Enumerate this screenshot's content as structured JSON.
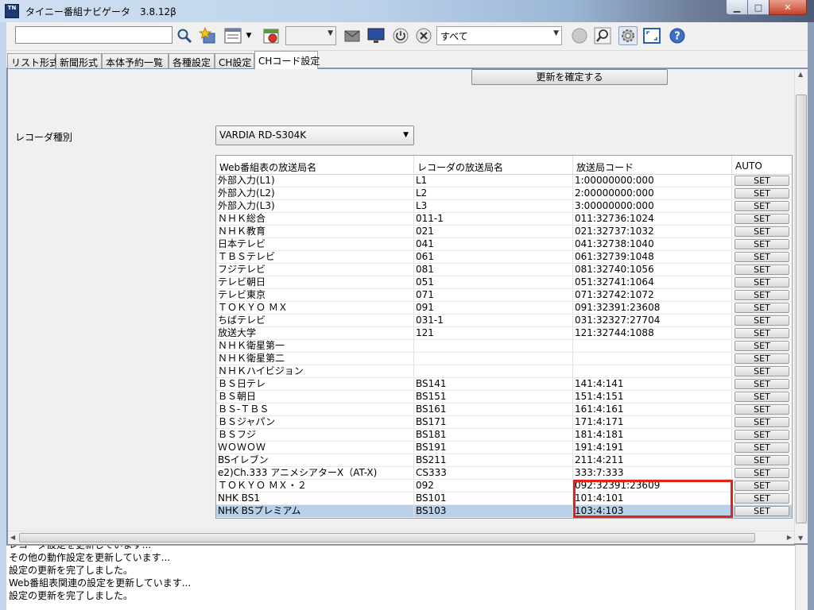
{
  "window": {
    "title": "タイニー番組ナビゲータ　3.8.12β",
    "icon_text": "TN"
  },
  "toolbar": {
    "search_value": "",
    "channel_combo_value": "",
    "filter_value": "すべて"
  },
  "tabs": [
    {
      "label": "リスト形式"
    },
    {
      "label": "新聞形式"
    },
    {
      "label": "本体予約一覧"
    },
    {
      "label": "各種設定"
    },
    {
      "label": "CH設定"
    },
    {
      "label": "CHコード設定"
    }
  ],
  "panel": {
    "update_button_label": "更新を確定する",
    "recorder_label": "レコーダ種別",
    "recorder_value": "VARDIA RD-S304K"
  },
  "table": {
    "headers": [
      "Web番組表の放送局名",
      "レコーダの放送局名",
      "放送局コード",
      "AUTO"
    ],
    "set_label": "SET",
    "rows": [
      {
        "web": "外部入力(L1)",
        "rec": "L1",
        "code": "1:00000000:000"
      },
      {
        "web": "外部入力(L2)",
        "rec": "L2",
        "code": "2:00000000:000"
      },
      {
        "web": "外部入力(L3)",
        "rec": "L3",
        "code": "3:00000000:000"
      },
      {
        "web": "ＮＨＫ総合",
        "rec": "011-1",
        "code": "011:32736:1024"
      },
      {
        "web": "ＮＨＫ教育",
        "rec": "021",
        "code": "021:32737:1032"
      },
      {
        "web": "日本テレビ",
        "rec": "041",
        "code": "041:32738:1040"
      },
      {
        "web": "ＴＢＳテレビ",
        "rec": "061",
        "code": "061:32739:1048"
      },
      {
        "web": "フジテレビ",
        "rec": "081",
        "code": "081:32740:1056"
      },
      {
        "web": "テレビ朝日",
        "rec": "051",
        "code": "051:32741:1064"
      },
      {
        "web": "テレビ東京",
        "rec": "071",
        "code": "071:32742:1072"
      },
      {
        "web": "ＴＯＫＹＯ ＭＸ",
        "rec": "091",
        "code": "091:32391:23608"
      },
      {
        "web": "ちばテレビ",
        "rec": "031-1",
        "code": "031:32327:27704"
      },
      {
        "web": "放送大学",
        "rec": "121",
        "code": "121:32744:1088"
      },
      {
        "web": "ＮＨＫ衛星第一",
        "rec": "",
        "code": ""
      },
      {
        "web": "ＮＨＫ衛星第二",
        "rec": "",
        "code": ""
      },
      {
        "web": "ＮＨＫハイビジョン",
        "rec": "",
        "code": ""
      },
      {
        "web": "ＢＳ日テレ",
        "rec": "BS141",
        "code": "141:4:141"
      },
      {
        "web": "ＢＳ朝日",
        "rec": "BS151",
        "code": "151:4:151"
      },
      {
        "web": "ＢＳ-ＴＢＳ",
        "rec": "BS161",
        "code": "161:4:161"
      },
      {
        "web": "ＢＳジャパン",
        "rec": "BS171",
        "code": "171:4:171"
      },
      {
        "web": "ＢＳフジ",
        "rec": "BS181",
        "code": "181:4:181"
      },
      {
        "web": "ＷＯＷＯＷ",
        "rec": "BS191",
        "code": "191:4:191"
      },
      {
        "web": "BSイレブン",
        "rec": "BS211",
        "code": "211:4:211"
      },
      {
        "web": "e2)Ch.333 アニメシアターX（AT-X)",
        "rec": "CS333",
        "code": "333:7:333"
      },
      {
        "web": "ＴＯＫＹＯ ＭＸ・２",
        "rec": "092",
        "code": "092:32391:23609"
      },
      {
        "web": "NHK BS1",
        "rec": "BS101",
        "code": "101:4:101"
      },
      {
        "web": "NHK BSプレミアム",
        "rec": "BS103",
        "code": "103:4:103",
        "selected": true
      }
    ]
  },
  "log": {
    "lines": [
      "レコーダ設定を更新しています...",
      "その他の動作設定を更新しています...",
      "設定の更新を完了しました。",
      "Web番組表関連の設定を更新しています...",
      "設定の更新を完了しました。"
    ]
  },
  "colors": {
    "highlight_box": "#e2231a",
    "selected_row": "#b8d1e9"
  },
  "icons": [
    "search-icon",
    "favorite-star-icon",
    "list-view-icon",
    "tv-guide-icon",
    "mail-icon",
    "monitor-icon",
    "power-icon",
    "stop-icon",
    "record-icon",
    "zoom-icon",
    "settings-gear-icon",
    "fullscreen-icon",
    "help-icon"
  ]
}
